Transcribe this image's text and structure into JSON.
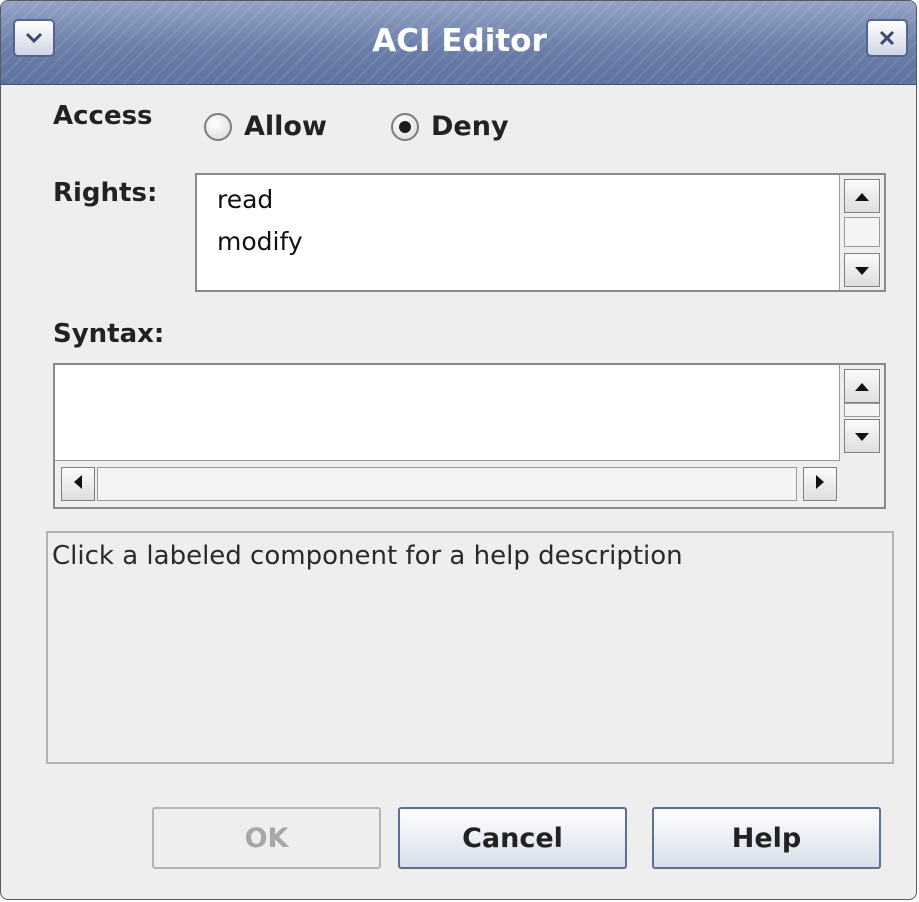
{
  "window": {
    "title": "ACI Editor"
  },
  "access": {
    "label": "Access",
    "options": [
      {
        "label": "Allow",
        "checked": false
      },
      {
        "label": "Deny",
        "checked": true
      }
    ]
  },
  "rights": {
    "label": "Rights:",
    "items": [
      "read",
      "modify"
    ]
  },
  "syntax": {
    "label": "Syntax:",
    "value": ""
  },
  "help": {
    "text": "Click a labeled component for a help description"
  },
  "buttons": {
    "ok": "OK",
    "ok_enabled": false,
    "cancel": "Cancel",
    "help": "Help"
  },
  "icons": {
    "menu": "chevron-down-icon",
    "close": "close-icon"
  }
}
